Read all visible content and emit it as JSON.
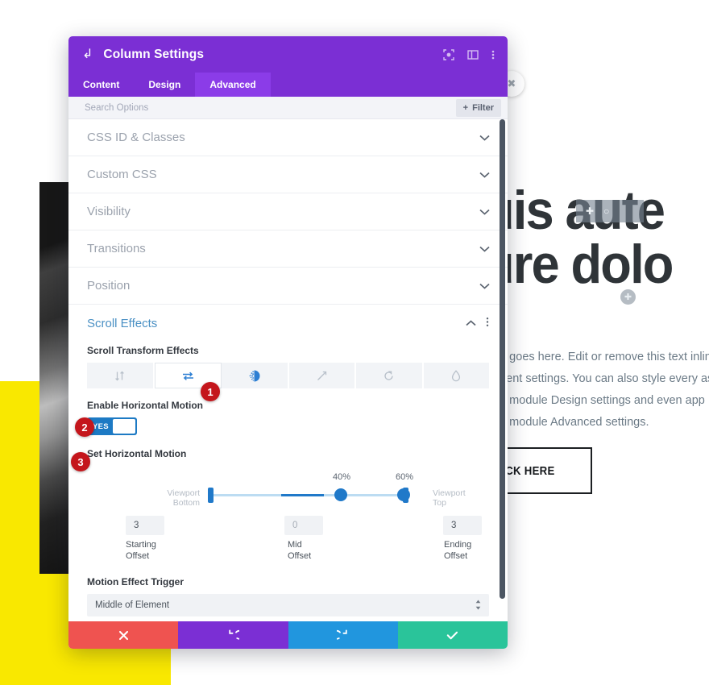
{
  "background": {
    "heading_line1": "uis aute",
    "heading_line2": "ure dolo",
    "paragraph": "ent goes here. Edit or remove this text inlin\nontent settings. You can also style every as\n the module Design settings and even app\n the module Advanced settings.",
    "paragraph_lines": [
      "ent goes here. Edit or remove this text inlin",
      "ontent settings. You can also style every as",
      " the module Design settings and even app",
      " the module Advanced settings."
    ],
    "button_label": "LICK HERE",
    "close_icon": "close-circle-icon",
    "module_move_icon": "move-icon",
    "module_settings_icon": "gear-icon",
    "module_add_icon": "plus-icon",
    "yellow_color": "#f9e800"
  },
  "modal": {
    "header": {
      "back_icon": "back-arrow-icon",
      "title": "Column Settings",
      "icons": [
        "focus-icon",
        "layout-panel-icon",
        "kebab-menu-icon"
      ]
    },
    "tabs": [
      {
        "label": "Content",
        "active": false
      },
      {
        "label": "Design",
        "active": false
      },
      {
        "label": "Advanced",
        "active": true
      }
    ],
    "search": {
      "placeholder": "Search Options",
      "filter_label": "Filter",
      "filter_icon": "plus-icon"
    },
    "sections": [
      {
        "label": "CSS ID & Classes",
        "state": "collapsed"
      },
      {
        "label": "Custom CSS",
        "state": "collapsed"
      },
      {
        "label": "Visibility",
        "state": "collapsed"
      },
      {
        "label": "Transitions",
        "state": "collapsed"
      },
      {
        "label": "Position",
        "state": "collapsed"
      }
    ],
    "scroll_effects": {
      "title": "Scroll Effects",
      "chevron_icon": "chevron-up-icon",
      "menu_icon": "kebab-menu-icon",
      "transform_label": "Scroll Transform Effects",
      "transform_icons": [
        {
          "name": "vertical-motion-icon",
          "state": "inactive"
        },
        {
          "name": "horizontal-motion-icon",
          "state": "selected"
        },
        {
          "name": "fading-icon",
          "state": "active"
        },
        {
          "name": "scaling-icon",
          "state": "inactive"
        },
        {
          "name": "rotating-icon",
          "state": "inactive"
        },
        {
          "name": "blur-icon",
          "state": "inactive"
        }
      ],
      "enable_label": "Enable Horizontal Motion",
      "toggle_value": "YES",
      "set_motion_label": "Set Horizontal Motion",
      "viewport_bottom": "Viewport\nBottom",
      "viewport_bottom_l1": "Viewport",
      "viewport_bottom_l2": "Bottom",
      "viewport_top_l1": "Viewport",
      "viewport_top_l2": "Top",
      "mid_start_pct": "40%",
      "mid_end_pct": "60%",
      "starting_offset_value": "3",
      "starting_offset_label_l1": "Starting",
      "starting_offset_label_l2": "Offset",
      "mid_offset_value": "0",
      "mid_offset_label_l1": "Mid",
      "mid_offset_label_l2": "Offset",
      "ending_offset_value": "3",
      "ending_offset_label_l1": "Ending",
      "ending_offset_label_l2": "Offset",
      "trigger_label": "Motion Effect Trigger",
      "trigger_value": "Middle of Element"
    },
    "footer": [
      {
        "name": "cancel",
        "icon": "close-x-icon",
        "color": "#ef5350"
      },
      {
        "name": "undo",
        "icon": "undo-icon",
        "color": "#7b2fd4"
      },
      {
        "name": "redo",
        "icon": "redo-icon",
        "color": "#2196de"
      },
      {
        "name": "save",
        "icon": "check-icon",
        "color": "#2ac49a"
      }
    ]
  },
  "annotations": [
    {
      "number": "1"
    },
    {
      "number": "2"
    },
    {
      "number": "3"
    }
  ]
}
